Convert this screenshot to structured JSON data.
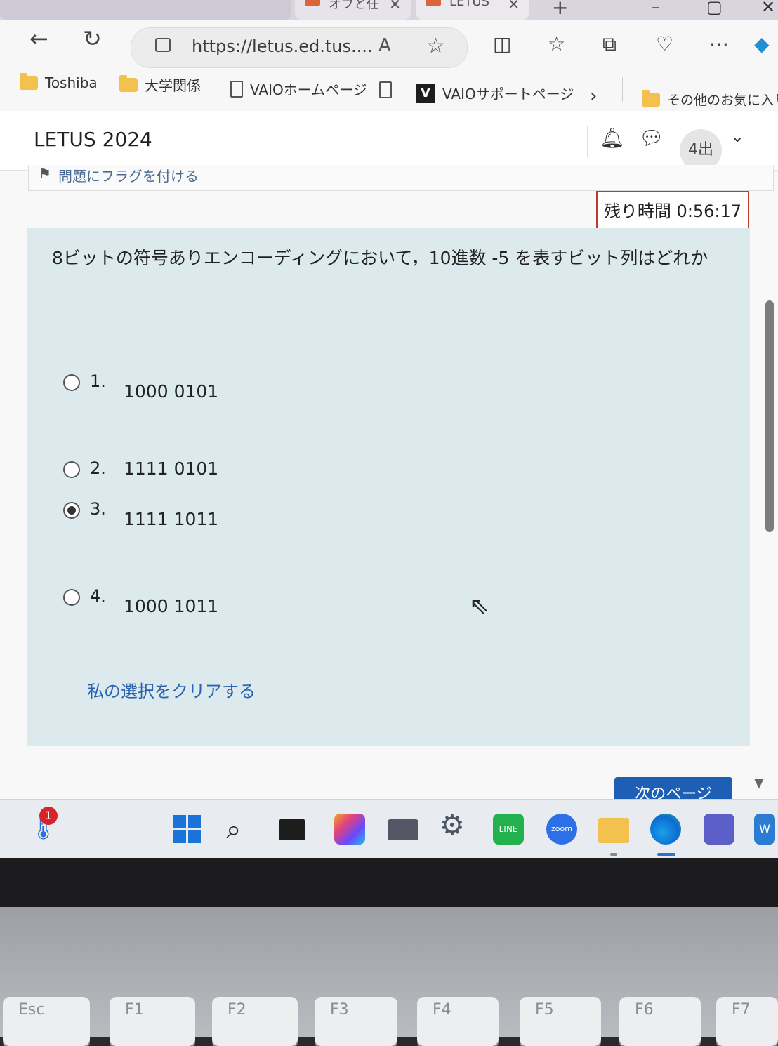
{
  "browser": {
    "tabs": [
      {
        "label": "",
        "close": ""
      },
      {
        "label": "オフと任",
        "close": "✕"
      },
      {
        "label": "LETUS",
        "close": "✕"
      }
    ],
    "new_tab": "+",
    "url": "https://letus.ed.tus....",
    "bookmarks": [
      {
        "label": "Toshiba",
        "icon": "folder-icon"
      },
      {
        "label": "大学関係",
        "icon": "folder-icon"
      },
      {
        "label": "VAIOホームページ",
        "icon": "page-icon"
      },
      {
        "label": "",
        "icon": "page-icon"
      },
      {
        "label": "VAIOサポートページ",
        "icon": "vaio-icon"
      },
      {
        "label": "その他のお気に入り",
        "icon": "folder-icon"
      }
    ],
    "bookmarks_more": "›"
  },
  "header": {
    "site_title": "LETUS 2024",
    "user_initials": "4出"
  },
  "quiz": {
    "flag_label": "問題にフラグを付ける",
    "timer": "残り時間 0:56:17",
    "question": "8ビットの符号ありエンコーディングにおいて，10進数 -5 を表すビット列はどれか",
    "options": [
      {
        "num": "1.",
        "value": "1000 0101",
        "selected": false
      },
      {
        "num": "2.",
        "value": "1111 0101",
        "selected": false
      },
      {
        "num": "3.",
        "value": "1111 1011",
        "selected": true
      },
      {
        "num": "4.",
        "value": "1000 1011",
        "selected": false
      }
    ],
    "clear_label": "私の選択をクリアする",
    "next_label": "次のページ"
  },
  "taskbar": {
    "notification_count": "1",
    "apps": [
      "weather-icon",
      "start-icon",
      "search-icon",
      "task-view-icon",
      "copilot-icon",
      "laptop-settings-icon",
      "settings-icon",
      "line-icon",
      "zoom-icon",
      "file-explorer-icon",
      "edge-icon",
      "teams-icon",
      "word-icon"
    ],
    "zoom_label": "zoom",
    "line_label": "LINE",
    "word_label": "W"
  },
  "keyboard": {
    "keys": [
      "Esc",
      "F1",
      "F2",
      "F3",
      "F4",
      "F5",
      "F6",
      "F7"
    ]
  },
  "colors": {
    "question_bg": "#dce9ed",
    "timer_border": "#c0392b",
    "link": "#2a64b0",
    "primary_button": "#1e5fb6"
  }
}
